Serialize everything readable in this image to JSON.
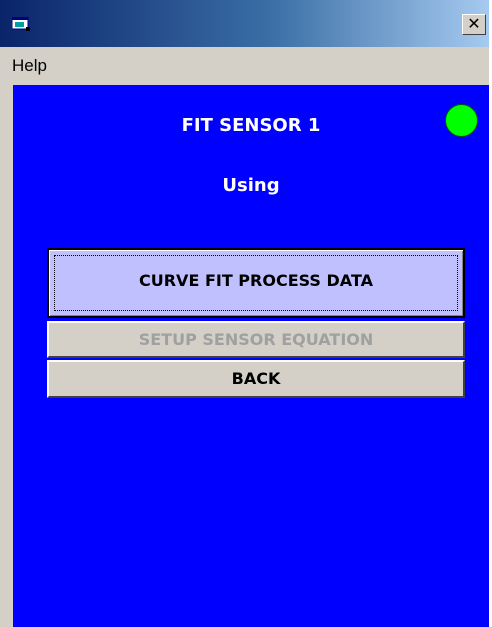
{
  "window": {
    "close_glyph": "✕"
  },
  "menubar": {
    "items": [
      {
        "label": "Help"
      }
    ]
  },
  "panel": {
    "title": "FIT SENSOR 1",
    "subtitle": "Using",
    "status_indicator_color": "#00ff00",
    "background_color": "#0000ff"
  },
  "buttons": {
    "curve_fit": "CURVE FIT PROCESS DATA",
    "setup_equation": "SETUP SENSOR EQUATION",
    "back": "BACK"
  }
}
